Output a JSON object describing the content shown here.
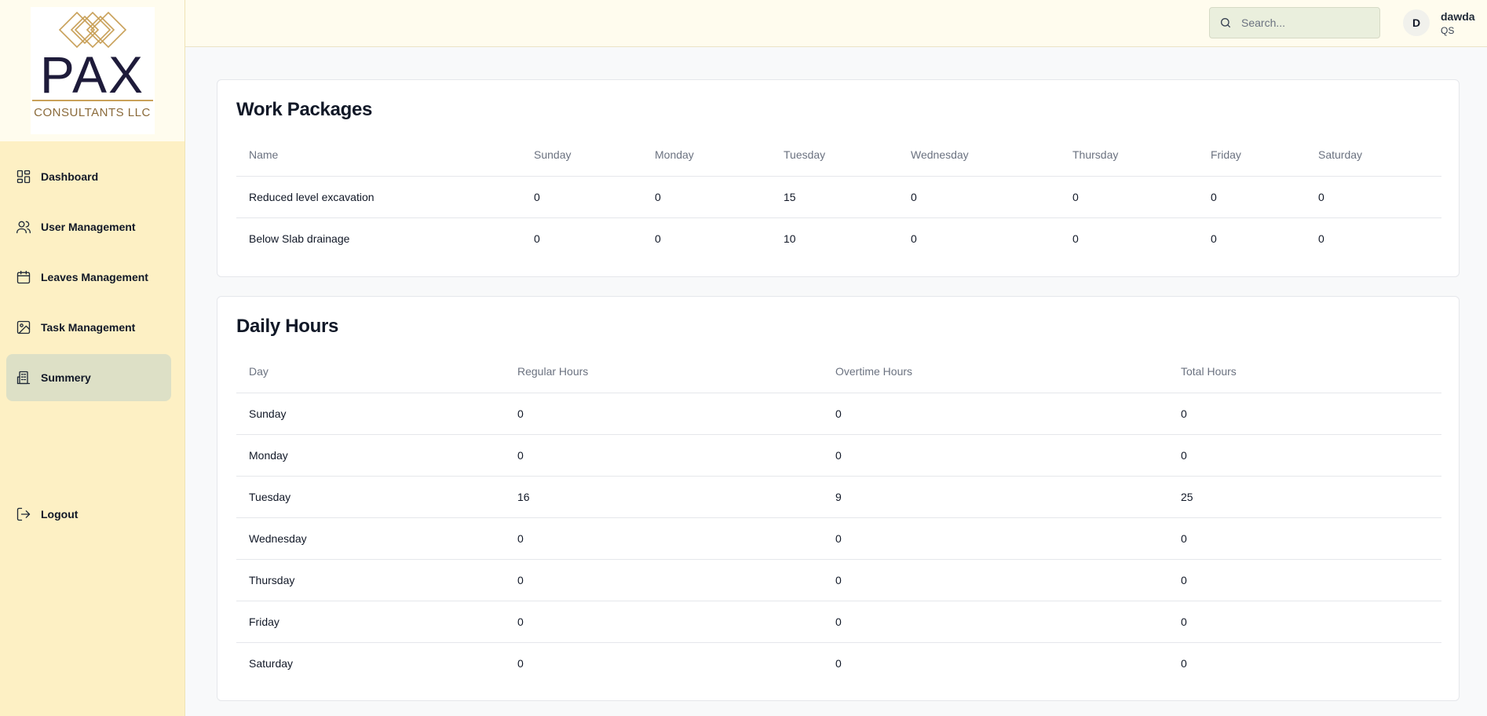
{
  "app": {
    "logo_word": "PAX",
    "logo_subtitle": "CONSULTANTS LLC",
    "brand_gold": "#c9a15a",
    "brand_navy": "#1e1b3a"
  },
  "sidebar": {
    "items": [
      {
        "label": "Dashboard",
        "icon": "dashboard-icon"
      },
      {
        "label": "User Management",
        "icon": "users-icon"
      },
      {
        "label": "Leaves Management",
        "icon": "calendar-icon"
      },
      {
        "label": "Task Management",
        "icon": "image-icon"
      },
      {
        "label": "Summery",
        "icon": "building-icon",
        "active": true
      }
    ],
    "logout_label": "Logout"
  },
  "topbar": {
    "search_placeholder": "Search...",
    "avatar_initial": "D",
    "user_name": "dawda",
    "user_role": "QS"
  },
  "work_packages": {
    "title": "Work Packages",
    "headers": [
      "Name",
      "Sunday",
      "Monday",
      "Tuesday",
      "Wednesday",
      "Thursday",
      "Friday",
      "Saturday"
    ],
    "rows": [
      [
        "Reduced level excavation",
        "0",
        "0",
        "15",
        "0",
        "0",
        "0",
        "0"
      ],
      [
        "Below Slab drainage",
        "0",
        "0",
        "10",
        "0",
        "0",
        "0",
        "0"
      ]
    ]
  },
  "daily_hours": {
    "title": "Daily Hours",
    "headers": [
      "Day",
      "Regular Hours",
      "Overtime Hours",
      "Total Hours"
    ],
    "rows": [
      [
        "Sunday",
        "0",
        "0",
        "0"
      ],
      [
        "Monday",
        "0",
        "0",
        "0"
      ],
      [
        "Tuesday",
        "16",
        "9",
        "25"
      ],
      [
        "Wednesday",
        "0",
        "0",
        "0"
      ],
      [
        "Thursday",
        "0",
        "0",
        "0"
      ],
      [
        "Friday",
        "0",
        "0",
        "0"
      ],
      [
        "Saturday",
        "0",
        "0",
        "0"
      ]
    ]
  }
}
